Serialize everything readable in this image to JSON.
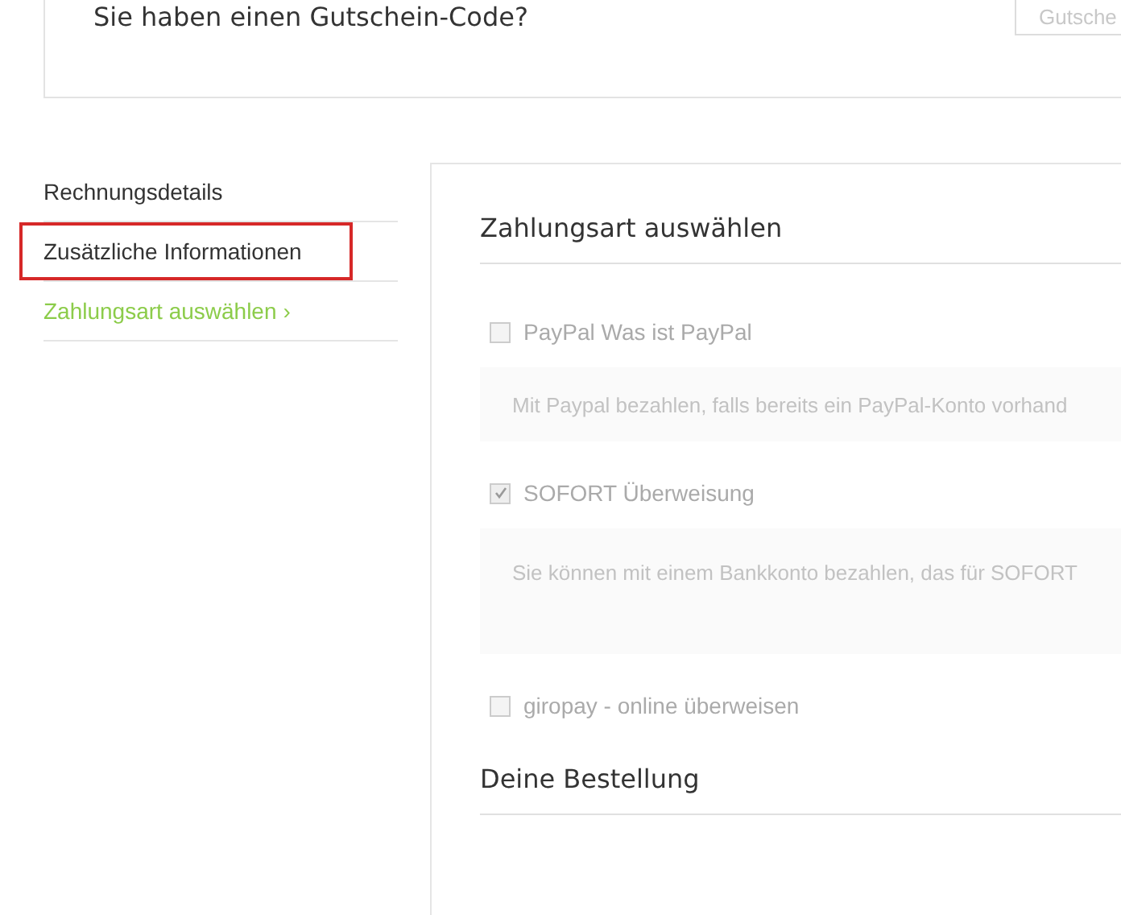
{
  "coupon": {
    "question": "Sie haben einen Gutschein-Code?",
    "placeholder": "Gutsche"
  },
  "sidebar": {
    "items": [
      {
        "label": "Rechnungsdetails",
        "selected": false,
        "highlighted": false
      },
      {
        "label": "Zusätzliche Informationen",
        "selected": false,
        "highlighted": true
      },
      {
        "label": "Zahlungsart auswählen",
        "chevron": "›",
        "selected": true,
        "highlighted": false
      }
    ]
  },
  "payment": {
    "heading": "Zahlungsart auswählen",
    "methods": [
      {
        "label": "PayPal Was ist PayPal",
        "checked": false,
        "description": "Mit Paypal bezahlen, falls bereits ein PayPal-Konto vorhand"
      },
      {
        "label": "SOFORT Überweisung",
        "checked": true,
        "description": "Sie können mit einem Bankkonto bezahlen, das für SOFORT"
      },
      {
        "label": "giropay - online überweisen",
        "checked": false
      }
    ]
  },
  "order": {
    "heading": "Deine Bestellung"
  }
}
